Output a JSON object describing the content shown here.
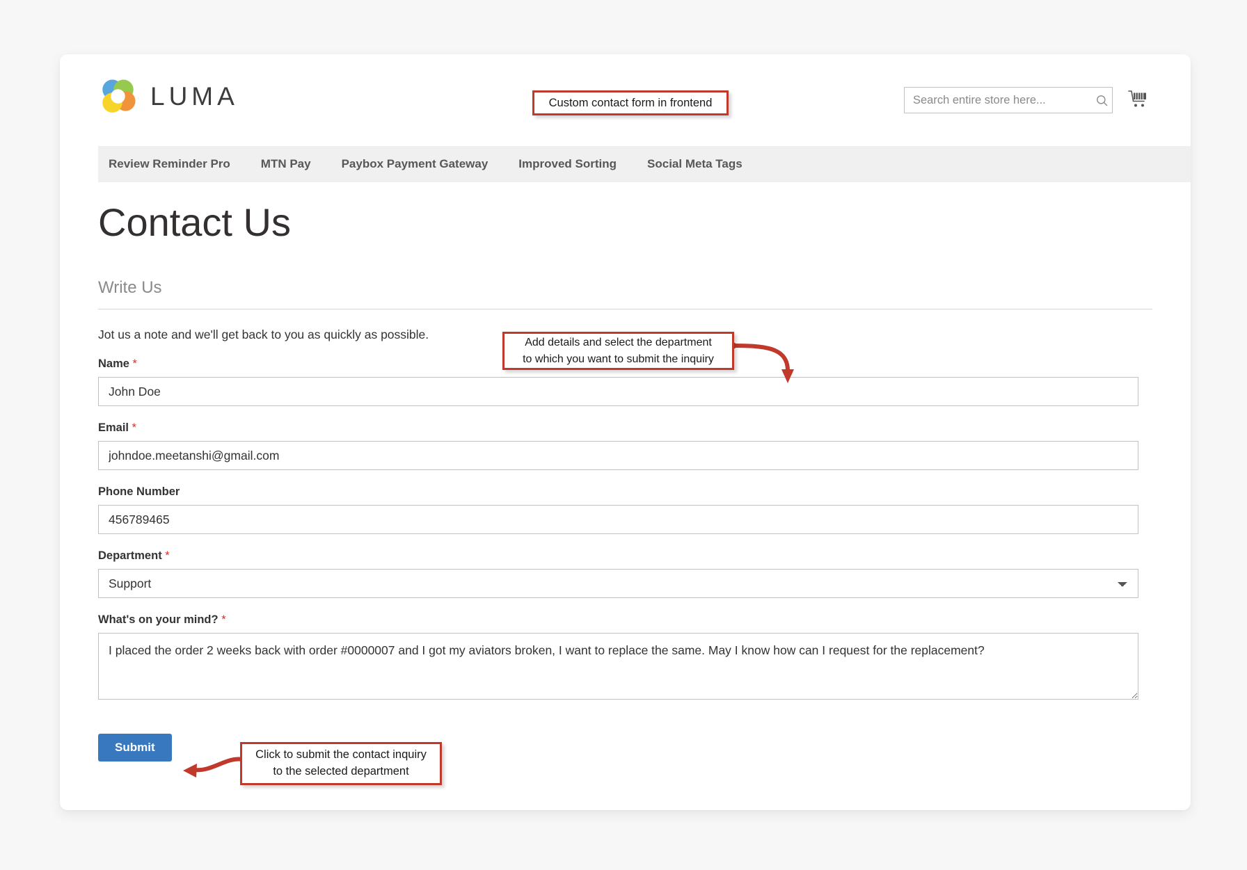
{
  "header": {
    "logo_text": "LUMA",
    "logo_icon": "luma-flower-logo",
    "search": {
      "placeholder": "Search entire store here...",
      "value": "",
      "icon": "search-icon"
    },
    "cart_icon": "shopping-cart-icon"
  },
  "nav": {
    "items": [
      {
        "label": "Review Reminder Pro"
      },
      {
        "label": "MTN Pay"
      },
      {
        "label": "Paybox Payment Gateway"
      },
      {
        "label": "Improved Sorting"
      },
      {
        "label": "Social Meta Tags"
      }
    ]
  },
  "page": {
    "title": "Contact Us",
    "legend": "Write Us",
    "note": "Jot us a note and we'll get back to you as quickly as possible."
  },
  "form": {
    "name": {
      "label": "Name",
      "required_mark": "*",
      "value": "John Doe",
      "placeholder": ""
    },
    "email": {
      "label": "Email",
      "required_mark": "*",
      "value": "johndoe.meetanshi@gmail.com",
      "placeholder": ""
    },
    "phone": {
      "label": "Phone Number",
      "required_mark": "",
      "value": "456789465",
      "placeholder": ""
    },
    "department": {
      "label": "Department",
      "required_mark": "*",
      "selected": "Support",
      "options": [
        "Support"
      ],
      "dropdown_icon": "chevron-down-icon"
    },
    "message": {
      "label": "What's on your mind?",
      "required_mark": "*",
      "value": "I placed the order 2 weeks back with order #0000007 and I got my aviators broken, I want to replace the same. May I know how can I request for the replacement?",
      "placeholder": "",
      "resize_handle_icon": "resize-grip-icon"
    },
    "submit": {
      "label": "Submit"
    }
  },
  "annotations": [
    {
      "id": "header",
      "text": "Custom contact form in frontend"
    },
    {
      "id": "department",
      "line1": "Add details and select the department",
      "line2": "to  which you want to submit the inquiry",
      "arrow_icon": "curved-arrow-down-icon"
    },
    {
      "id": "submit",
      "line1": "Click to submit the contact inquiry",
      "line2": "to the selected department",
      "arrow_icon": "curved-arrow-left-icon"
    }
  ],
  "colors": {
    "page_background": "#f7f7f7",
    "card_background": "#ffffff",
    "nav_background": "#f0f0f0",
    "annotation_border": "#c0392b",
    "annotation_arrow": "#c0392b",
    "submit_button": "#3778be",
    "required_mark": "#e02b27",
    "title_text": "#33302f",
    "legend_text": "#8a8a8a"
  }
}
